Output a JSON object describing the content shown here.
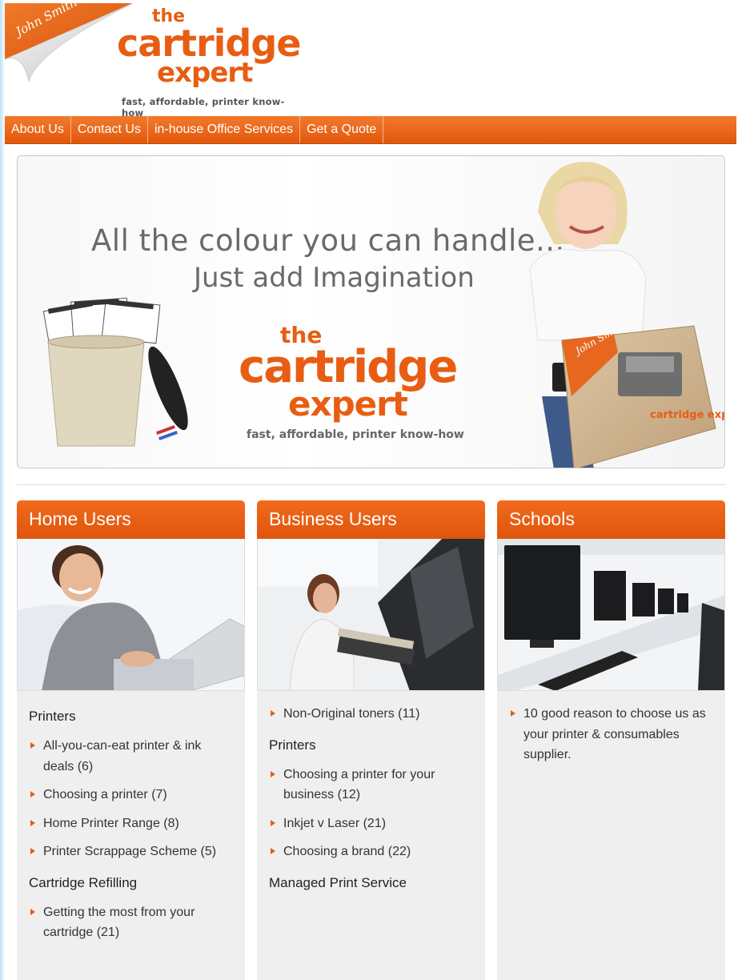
{
  "header": {
    "signature": "John Smith",
    "logo_the": "the",
    "logo_cartridge": "cartridge",
    "logo_expert": "expert",
    "tagline": "fast, affordable, printer know-how"
  },
  "nav": [
    {
      "label": "About Us"
    },
    {
      "label": "Contact Us"
    },
    {
      "label": "in-house Office Services"
    },
    {
      "label": "Get a Quote"
    }
  ],
  "banner": {
    "line1": "All the colour you can handle...",
    "line2": "Just add Imagination",
    "logo_the": "the",
    "logo_cartridge": "cartridge",
    "logo_expert": "expert",
    "tagline": "fast, affordable, printer know-how",
    "box_signature": "John Smith",
    "box_logo": "cartridge expert"
  },
  "columns": [
    {
      "title": "Home Users",
      "sections": [
        {
          "title": "Printers",
          "items": [
            "All-you-can-eat printer & ink deals (6)",
            "Choosing a printer (7)",
            "Home Printer Range (8)",
            "Printer Scrappage Scheme (5)"
          ]
        },
        {
          "title": "Cartridge Refilling",
          "items": [
            "Getting the most from your cartridge (21)"
          ]
        }
      ]
    },
    {
      "title": "Business Users",
      "sections": [
        {
          "title": "",
          "items": [
            "Non-Original toners (11)"
          ]
        },
        {
          "title": "Printers",
          "items": [
            "Choosing a printer for your business (12)",
            "Inkjet v Laser (21)",
            "Choosing a brand (22)"
          ]
        },
        {
          "title": "Managed Print Service",
          "items": []
        }
      ]
    },
    {
      "title": "Schools",
      "sections": [
        {
          "title": "",
          "items": [
            "10 good reason to choose us as your printer & consumables supplier."
          ]
        }
      ]
    }
  ],
  "colors": {
    "accent": "#e85d12",
    "panel": "#efefef"
  }
}
